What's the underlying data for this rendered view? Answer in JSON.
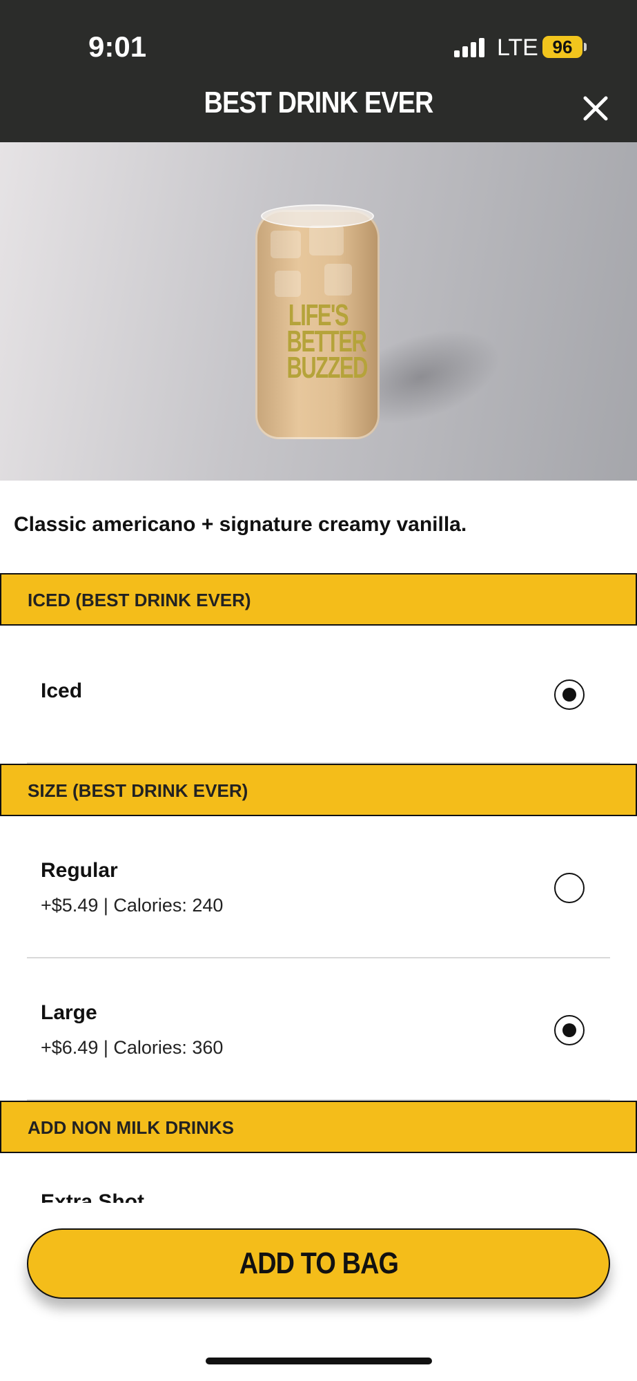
{
  "status_bar": {
    "time": "9:01",
    "network": "LTE",
    "battery": "96"
  },
  "header": {
    "title": "BEST DRINK EVER"
  },
  "product_image": {
    "glass_text": "LIFE'S BETTER BUZZED"
  },
  "description": "Classic americano + signature creamy vanilla.",
  "sections": {
    "iced": {
      "title": "ICED (BEST DRINK EVER)",
      "options": [
        {
          "name": "Iced",
          "meta": "",
          "selected": true
        }
      ]
    },
    "size": {
      "title": "SIZE (BEST DRINK EVER)",
      "options": [
        {
          "name": "Regular",
          "meta": "+$5.49 | Calories: 240",
          "selected": false
        },
        {
          "name": "Large",
          "meta": "+$6.49 | Calories: 360",
          "selected": true
        }
      ]
    },
    "add_non_milk": {
      "title": "ADD NON MILK DRINKS",
      "partial_option": "Extra Shot"
    }
  },
  "cta": {
    "label": "ADD TO BAG"
  },
  "colors": {
    "header_bg": "#2b2c2a",
    "accent_yellow": "#f4bd1a",
    "battery_yellow": "#f2c51d"
  }
}
